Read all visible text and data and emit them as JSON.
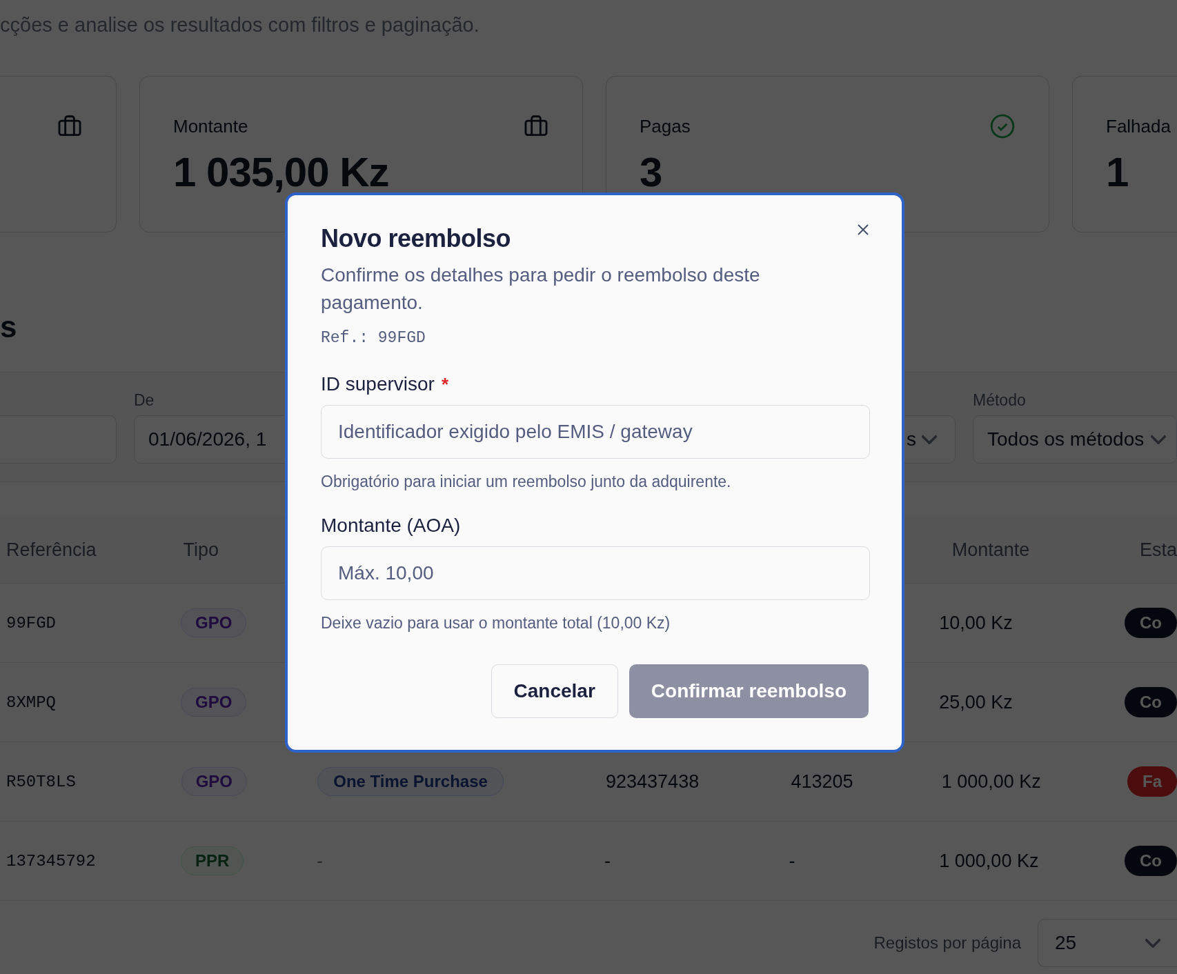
{
  "page": {
    "subtitle": "cções e analise os resultados com filtros e paginação.",
    "heading": "s"
  },
  "stats": [
    {
      "kind": "total"
    },
    {
      "kind": "amount",
      "label": "Montante",
      "value": "1 035,00 Kz"
    },
    {
      "kind": "paid",
      "label": "Pagas",
      "value": "3"
    },
    {
      "kind": "failed",
      "label": "Falhada",
      "value": "1"
    }
  ],
  "filters": {
    "from_label": "De",
    "from_value": "01/06/2026, 1",
    "select_value": "s",
    "method_label": "Método",
    "method_value": "Todos os métodos"
  },
  "table": {
    "header": {
      "reference": "Referência",
      "type": "Tipo",
      "amount": "Montante",
      "status": "Esta"
    },
    "rows": [
      {
        "reference": "99FGD",
        "type": {
          "label": "GPO",
          "kind": "purple"
        },
        "amount": "10,00 Kz",
        "status": {
          "label": "Co",
          "kind": "success"
        }
      },
      {
        "reference": "8XMPQ",
        "type": {
          "label": "GPO",
          "kind": "purple"
        },
        "amount": "25,00 Kz",
        "status": {
          "label": "Co",
          "kind": "success"
        }
      },
      {
        "reference": "R50T8LS",
        "type": {
          "label": "GPO",
          "kind": "purple"
        },
        "column_3": "One Time Purchase",
        "column_4": "923437438",
        "column_5": "413205",
        "amount": "1 000,00 Kz",
        "status": {
          "label": "Fa",
          "kind": "failed"
        }
      },
      {
        "reference": "137345792",
        "type": {
          "label": "PPR",
          "kind": "green"
        },
        "column_3": "-",
        "column_4": "-",
        "column_5": "-",
        "amount": "1 000,00 Kz",
        "status": {
          "label": "Co",
          "kind": "success"
        }
      }
    ]
  },
  "pagination": {
    "label": "Registos por página",
    "value": "25"
  },
  "dialog": {
    "title": "Novo reembolso",
    "description": "Confirme os detalhes para pedir o reembolso deste pagamento.",
    "reference": "Ref.: 99FGD",
    "fields": [
      {
        "label": "ID supervisor",
        "required_mark": "*",
        "placeholder": "Identificador exigido pelo EMIS / gateway",
        "hint": "Obrigatório para iniciar um reembolso junto da adquirente."
      },
      {
        "label": "Montante (AOA)",
        "placeholder": "Máx. 10,00",
        "hint": "Deixe vazio para usar o montante total (10,00 Kz)"
      }
    ],
    "cancel": "Cancelar",
    "confirm": "Confirmar reembolso",
    "confirm_disabled": true
  }
}
